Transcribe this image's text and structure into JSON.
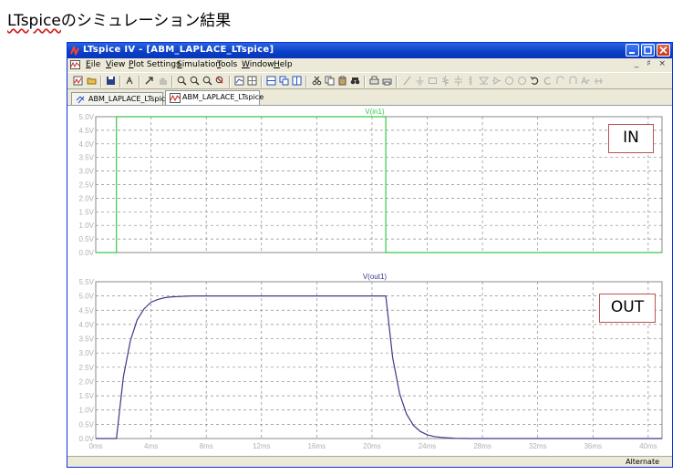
{
  "slide": {
    "title_latin": "LTspice",
    "title_rest": "のシミュレーション結果"
  },
  "window": {
    "title": "LTspice IV - [ABM_LAPLACE_LTspice]",
    "menu": [
      {
        "key": "E",
        "rest": "ile"
      },
      {
        "key": "V",
        "rest": "iew"
      },
      {
        "key": "P",
        "rest": "lot Settings"
      },
      {
        "key": "S",
        "rest": "imulation"
      },
      {
        "key": "T",
        "rest": "ools"
      },
      {
        "key": "W",
        "rest": "indow"
      },
      {
        "key": "H",
        "rest": "elp"
      }
    ],
    "mdi_controls": "_ ♯ ×",
    "tabs": [
      "ABM_LAPLACE_LTspice",
      "ABM_LAPLACE_LTspice"
    ],
    "status_right": "Alternate"
  },
  "annotations": {
    "in_label": "IN",
    "out_label": "OUT"
  },
  "colors": {
    "in_trace": "#36c84a",
    "out_trace": "#3a3a8c",
    "grid": "#8a8a8a",
    "axis_text": "#b0b0b0"
  },
  "chart_data": [
    {
      "type": "line",
      "series": [
        {
          "name": "V(in1)",
          "x": [
            0,
            1.5,
            1.5,
            21,
            21,
            41
          ],
          "y": [
            0,
            0,
            5,
            5,
            0,
            0
          ]
        }
      ],
      "yticks": [
        "5.0V",
        "4.5V",
        "4.0V",
        "3.5V",
        "3.0V",
        "2.5V",
        "2.0V",
        "1.5V",
        "1.0V",
        "0.5V",
        "0.0V"
      ],
      "xlim": [
        0,
        41
      ],
      "ylim": [
        0,
        5
      ],
      "grid": true
    },
    {
      "type": "line",
      "series": [
        {
          "name": "V(out1)",
          "x": [
            0,
            1.5,
            2.0,
            2.5,
            3.0,
            3.5,
            4.0,
            4.5,
            5.0,
            5.5,
            6.0,
            6.5,
            7.0,
            8.0,
            10,
            14,
            21,
            21.5,
            22,
            22.5,
            23,
            23.5,
            24,
            24.5,
            25,
            26,
            27,
            28,
            30,
            34,
            41
          ],
          "y": [
            0,
            0,
            2.16,
            3.42,
            4.16,
            4.55,
            4.78,
            4.88,
            4.94,
            4.97,
            4.98,
            4.99,
            5.0,
            5.0,
            5.0,
            5.0,
            5.0,
            2.84,
            1.58,
            0.86,
            0.46,
            0.25,
            0.13,
            0.07,
            0.04,
            0.01,
            0.0,
            0.0,
            0.0,
            0.0,
            0.0
          ]
        }
      ],
      "yticks": [
        "5.5V",
        "5.0V",
        "4.5V",
        "4.0V",
        "3.5V",
        "3.0V",
        "2.5V",
        "2.0V",
        "1.5V",
        "1.0V",
        "0.5V",
        "0.0V"
      ],
      "xticks": [
        "0ms",
        "4ms",
        "8ms",
        "12ms",
        "16ms",
        "20ms",
        "24ms",
        "28ms",
        "32ms",
        "36ms",
        "40ms"
      ],
      "xlim": [
        0,
        41
      ],
      "ylim": [
        0,
        5.5
      ],
      "grid": true
    }
  ]
}
